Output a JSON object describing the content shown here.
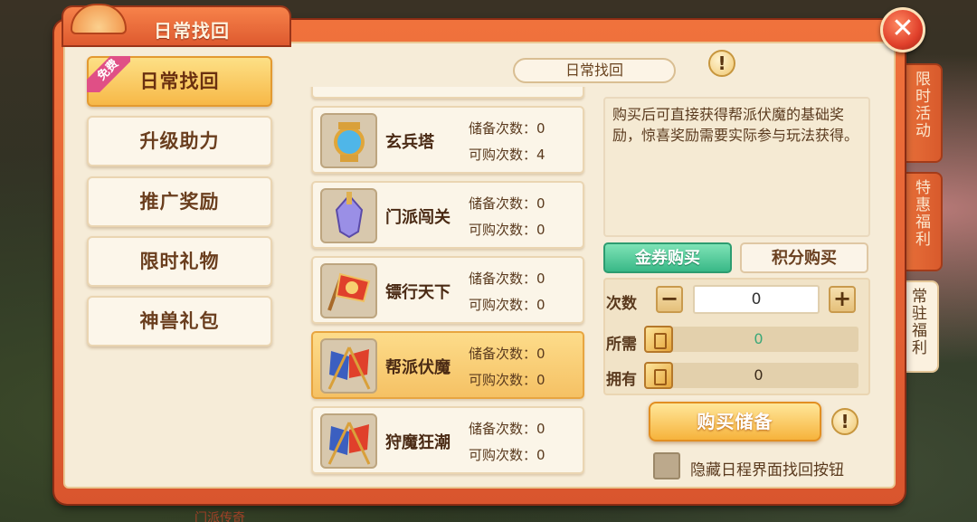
{
  "window": {
    "title": "日常找回",
    "close_label": "✕"
  },
  "background": {
    "text": "门派传奇"
  },
  "menu": {
    "free_tag": "免费",
    "items": [
      {
        "label": "日常找回"
      },
      {
        "label": "升级助力"
      },
      {
        "label": "推广奖励"
      },
      {
        "label": "限时礼物"
      },
      {
        "label": "神兽礼包"
      }
    ]
  },
  "list": {
    "items": [
      {
        "name": "玄兵塔",
        "reserve": "储备次数：0",
        "buyable": "可购次数：4",
        "icon": "tower-icon"
      },
      {
        "name": "门派闯关",
        "reserve": "储备次数：0",
        "buyable": "可购次数：0",
        "icon": "sword-icon"
      },
      {
        "name": "镖行天下",
        "reserve": "储备次数：0",
        "buyable": "可购次数：0",
        "icon": "banner-icon"
      },
      {
        "name": "帮派伏魔",
        "reserve": "储备次数：0",
        "buyable": "可购次数：0",
        "icon": "flags-icon"
      },
      {
        "name": "狩魔狂潮",
        "reserve": "储备次数：0",
        "buyable": "可购次数：0",
        "icon": "flags-icon"
      }
    ]
  },
  "detail": {
    "title": "日常找回",
    "info_label": "!",
    "description": "购买后可直接获得帮派伏魔的基础奖励，惊喜奖励需要实际参与玩法获得。",
    "tabs": {
      "gold": "金券购买",
      "points": "积分购买"
    },
    "count_label": "次数",
    "minus": "−",
    "plus": "+",
    "count_value": "0",
    "need_label": "所需",
    "need_value": "0",
    "own_label": "拥有",
    "own_value": "0",
    "buy_button": "购买储备",
    "hide_label": "隐藏日程界面找回按钮"
  },
  "side_tabs": [
    {
      "label": "限时活动"
    },
    {
      "label": "特惠福利"
    },
    {
      "label": "常驻福利"
    }
  ],
  "colors": {
    "accent": "#e9663a",
    "selected": "#f5c164",
    "green": "#39b887"
  }
}
